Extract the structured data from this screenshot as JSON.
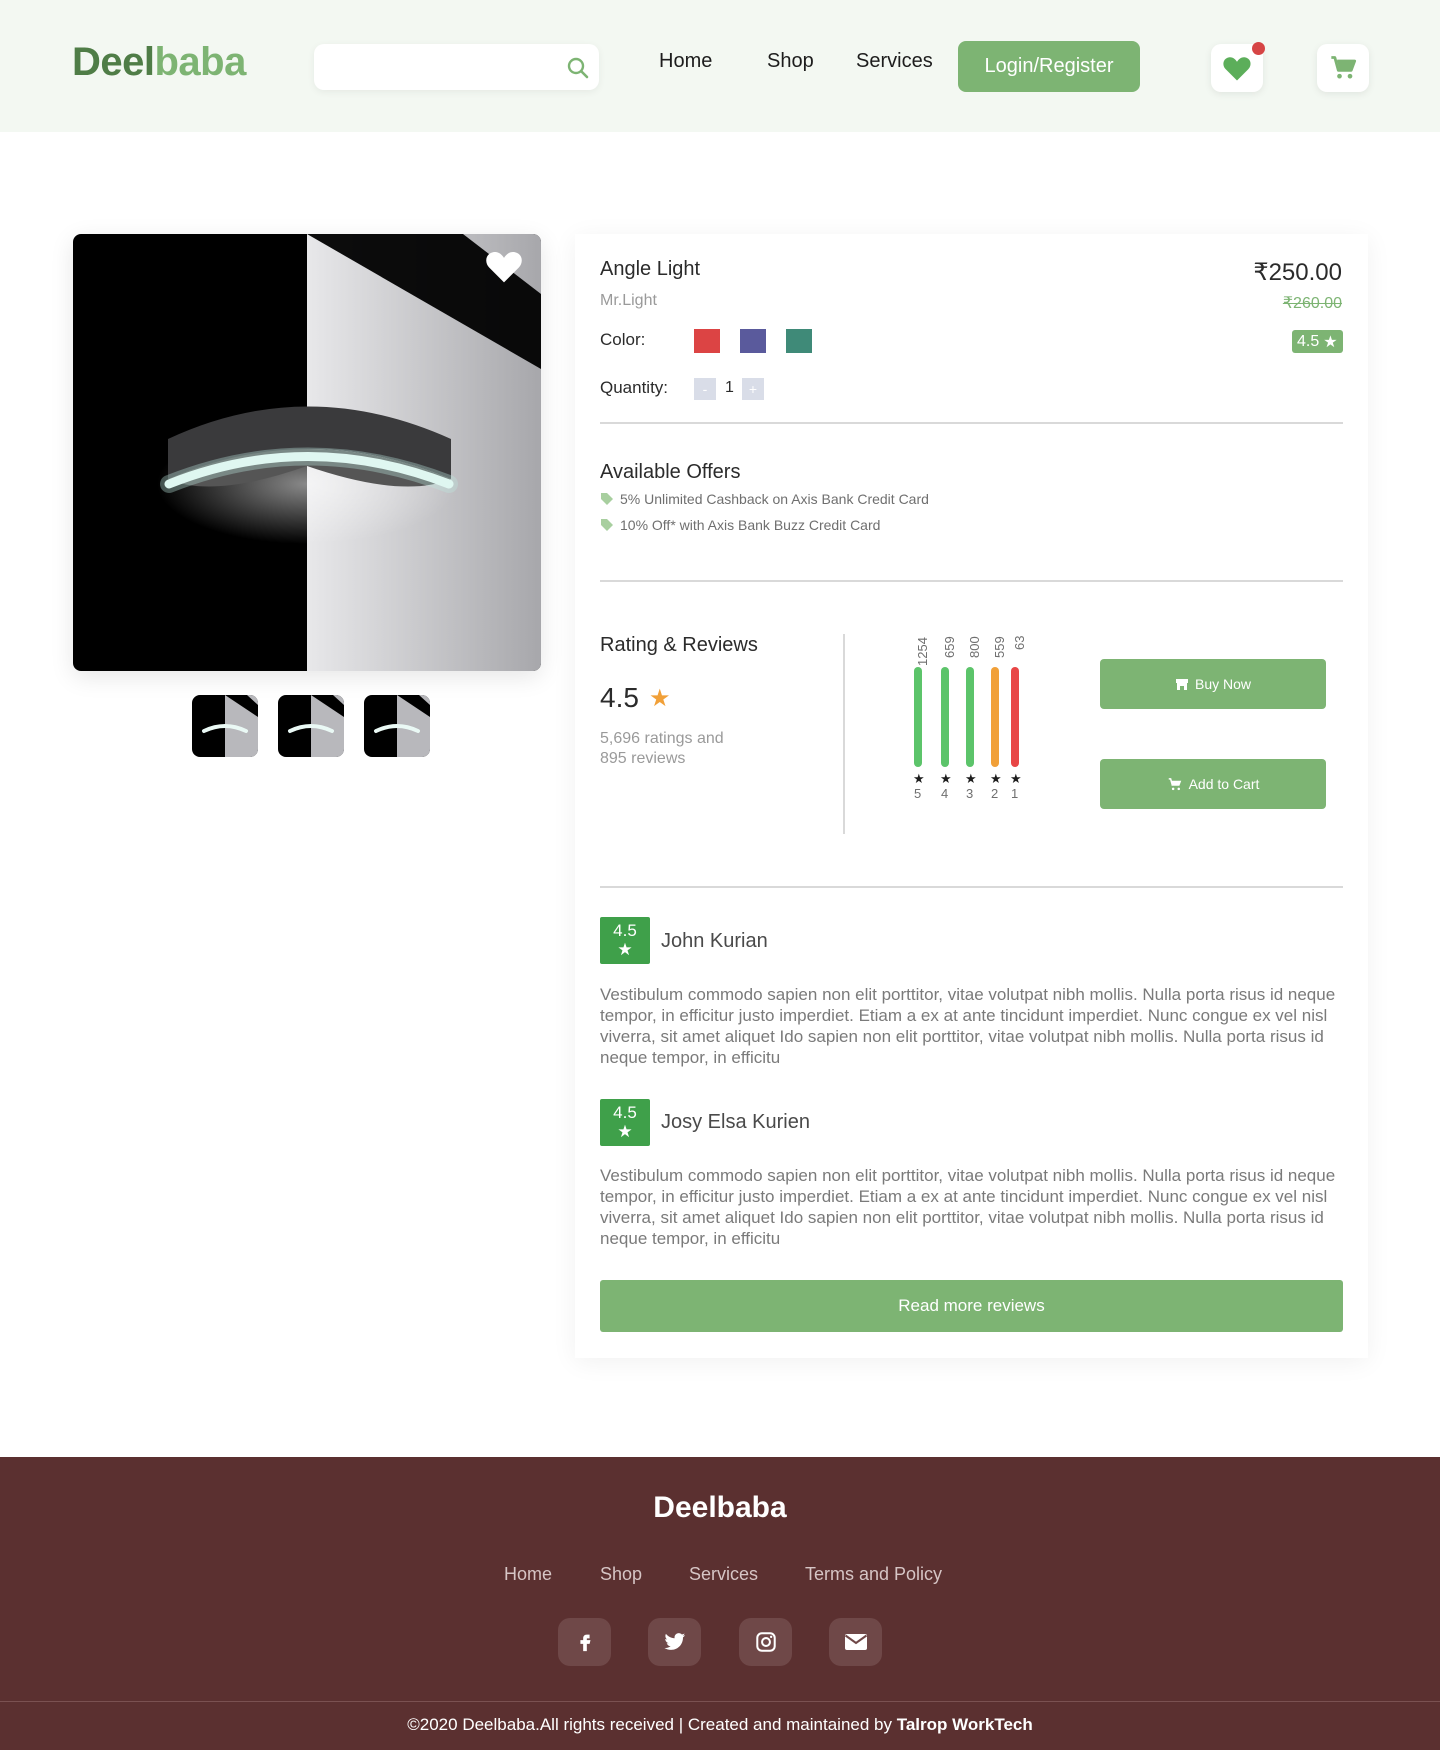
{
  "header": {
    "logo_part1": "Deel",
    "logo_part2": "baba",
    "search_placeholder": "",
    "nav": [
      "Home",
      "Shop",
      "Services"
    ],
    "login_label": "Login/Register"
  },
  "product": {
    "name": "Angle Light",
    "brand": "Mr.Light",
    "price": "₹250.00",
    "old_price": "₹260.00",
    "rating": "4.5",
    "color_label": "Color:",
    "colors": [
      "#dc4444",
      "#5a5a9c",
      "#3f8a78"
    ],
    "quantity_label": "Quantity:",
    "quantity": "1",
    "minus": "-",
    "plus": "+"
  },
  "offers": {
    "title": "Available Offers",
    "items": [
      "5% Unlimited Cashback on Axis Bank Credit Card",
      "10% Off* with Axis Bank Buzz Credit Card"
    ]
  },
  "ratings": {
    "title": "Rating & Reviews",
    "average": "4.5",
    "count_line1": "5,696 ratings and",
    "count_line2": "895 reviews",
    "distribution": [
      {
        "star": "5",
        "count": 1254,
        "color": "#5cc46a"
      },
      {
        "star": "4",
        "count": 659,
        "color": "#5cc46a"
      },
      {
        "star": "3",
        "count": 800,
        "color": "#5cc46a"
      },
      {
        "star": "2",
        "count": 559,
        "color": "#f1a038"
      },
      {
        "star": "1",
        "count": 63,
        "color": "#e84646"
      }
    ],
    "buy_now": "Buy Now",
    "add_to_cart": "Add to Cart"
  },
  "reviews": [
    {
      "rating": "4.5",
      "name": "John Kurian",
      "text": "Vestibulum commodo sapien non elit porttitor, vitae volutpat nibh mollis. Nulla porta risus id neque tempor, in efficitur justo imperdiet. Etiam a ex at ante tincidunt imperdiet. Nunc congue ex vel nisl viverra, sit amet aliquet Ido sapien non elit porttitor, vitae volutpat nibh mollis. Nulla porta risus id neque tempor, in efficitu"
    },
    {
      "rating": "4.5",
      "name": "Josy Elsa Kurien",
      "text": "Vestibulum commodo sapien non elit porttitor, vitae volutpat nibh mollis. Nulla porta risus id neque tempor, in efficitur justo imperdiet. Etiam a ex at ante tincidunt imperdiet. Nunc congue ex vel nisl viverra, sit amet aliquet Ido sapien non elit porttitor, vitae volutpat nibh mollis. Nulla porta risus id neque tempor, in efficitu"
    }
  ],
  "read_more": "Read more reviews",
  "footer": {
    "logo": "Deelbaba",
    "links": [
      "Home",
      "Shop",
      "Services",
      "Terms and Policy"
    ],
    "social_icons": [
      "facebook-icon",
      "twitter-icon",
      "instagram-icon",
      "email-icon"
    ],
    "copyright_prefix": "©2020 Deelbaba.All rights received | Created and maintained by",
    "copyright_company": "Talrop WorkTech"
  },
  "colors": {
    "accent_green": "#7db473",
    "header_bg": "#f3f8f2",
    "footer_bg": "#5b3030"
  }
}
